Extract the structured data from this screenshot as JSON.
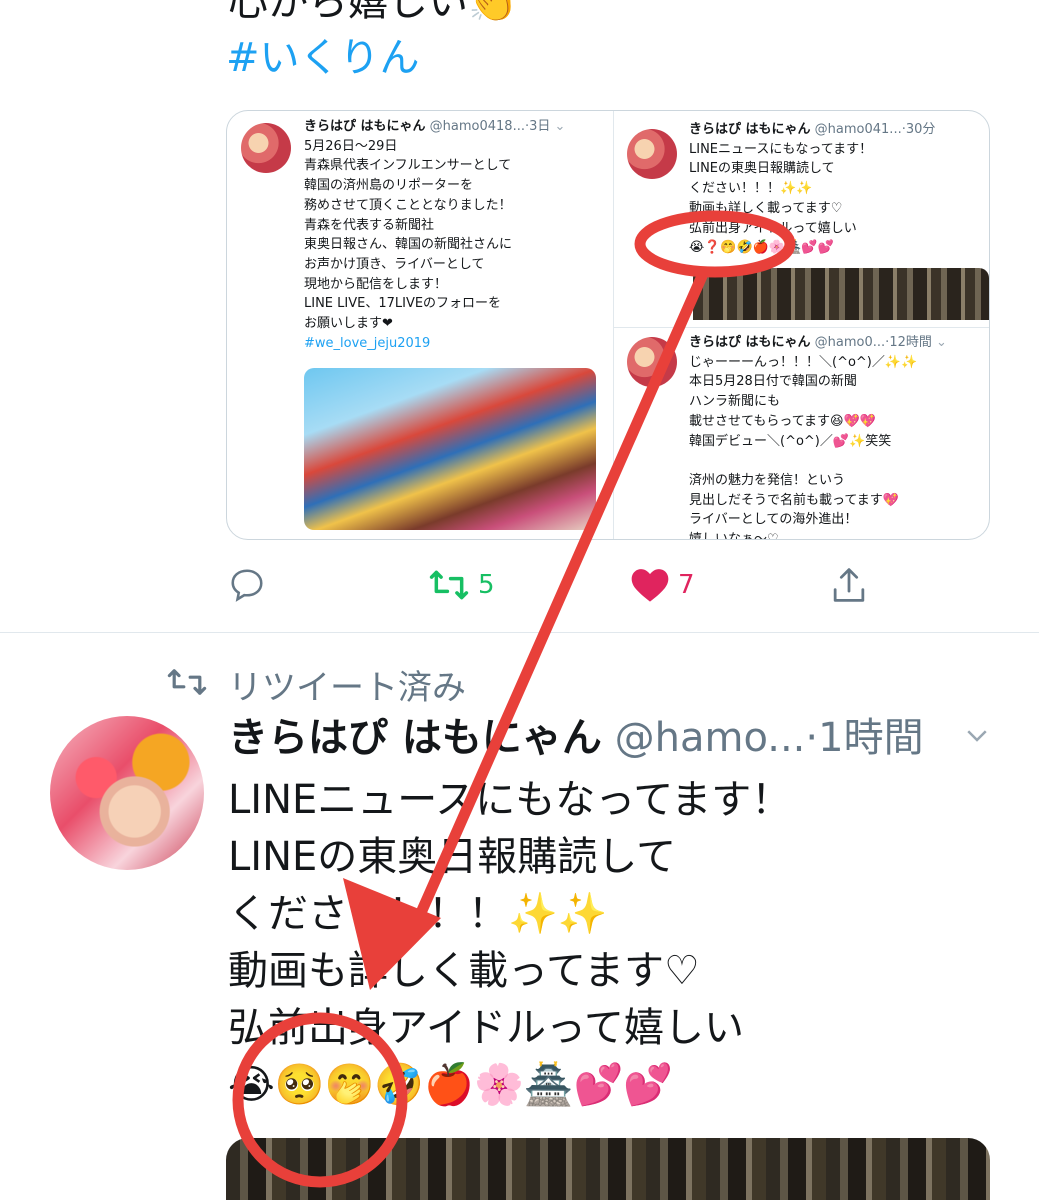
{
  "top_tweet": {
    "text_line": "心から嬉しい👏",
    "hashtag": "#いくりん"
  },
  "embedded_card": {
    "left_tweet": {
      "name": "きらはぴ はもにゃん",
      "handle": "@hamo0418...",
      "time": "3日",
      "lines": [
        "5月26日〜29日",
        "青森県代表インフルエンサーとして",
        "韓国の済州島のリポーターを",
        "務めさせて頂くこととなりました！",
        "青森を代表する新聞社",
        "東奥日報さん、韓国の新聞社さんに",
        "お声かけ頂き、ライバーとして",
        "現地から配信をします！",
        "LINE LIVE、17LIVEのフォローを",
        "お願いします❤"
      ],
      "hashtag": "#we_love_jeju2019"
    },
    "right_top_tweet": {
      "name": "きらはぴ はもにゃん",
      "handle": "@hamo041...",
      "time": "30分",
      "lines": [
        "LINEニュースにもなってます！",
        "LINEの東奥日報購読して",
        "ください！！！✨✨",
        "動画も詳しく載ってます♡",
        "弘前出身アイドルって嬉しい",
        "😭❓🤭🤣🍎🌸🏯💕💕"
      ]
    },
    "right_bottom_tweet": {
      "name": "きらはぴ はもにゃん",
      "handle": "@hamo0...",
      "time": "12時間",
      "lines": [
        "じゃーーーんっ！！！＼(^o^)／✨✨",
        "本日5月28日付で韓国の新聞",
        "ハンラ新聞にも",
        "載せさせてもらってます😆💖💖",
        "韓国デビュー＼(^o^)／💕✨笑笑",
        "",
        "済州の魅力を発信！という",
        "見出しだそうで名前も載ってます💖",
        "ライバーとしての海外進出！",
        "嬉しいなぁ〜♡"
      ]
    }
  },
  "actions": {
    "retweet_count": "5",
    "like_count": "7"
  },
  "retweet_header": {
    "label": "リツイート済み"
  },
  "main_tweet": {
    "name": "きらはぴ はもにゃん",
    "handle": "@hamo...",
    "time": "·1時間",
    "lines": [
      "LINEニュースにもなってます！",
      "LINEの東奥日報購読して",
      "ください！！！✨✨",
      "動画も詳しく載ってます♡",
      "弘前出身アイドルって嬉しい",
      "😭🥺🤭🤣🍎🌸🏯💕💕"
    ]
  },
  "colors": {
    "accent_blue": "#1da1f2",
    "retweet_green": "#17bf63",
    "like_red": "#e0245e",
    "annotation_red": "#e8403a",
    "muted_gray": "#657786"
  }
}
